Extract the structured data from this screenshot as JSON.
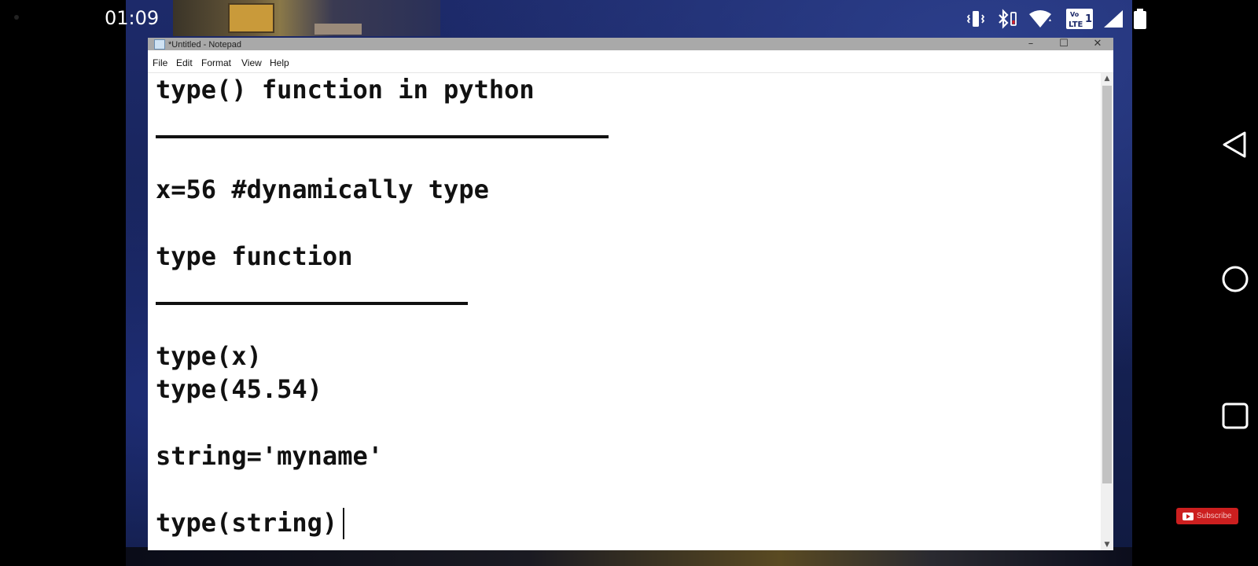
{
  "status_bar": {
    "time": "01:09",
    "icons": [
      "vibrate-icon",
      "bluetooth-icon",
      "wifi-icon",
      "volte-lte-icon",
      "cellular-signal-icon",
      "battery-icon"
    ],
    "lte_badge": "LTE 1"
  },
  "window": {
    "title": "*Untitled - Notepad",
    "controls": {
      "minimize": "–",
      "maximize": "☐",
      "close": "✕"
    }
  },
  "menu": [
    "File",
    "Edit",
    "Format",
    "View",
    "Help"
  ],
  "editor": {
    "lines": [
      "type() function in python",
      "x=56 #dynamically type",
      "type function",
      "type(x)",
      "type(45.54)",
      "string='myname'",
      "type(string)"
    ]
  },
  "nav_bar": {
    "icons": [
      "back-icon",
      "home-icon",
      "recents-icon"
    ]
  },
  "overlay": {
    "subscribe_label": "Subscribe"
  },
  "colors": {
    "subscribe_red": "#cc1f1f",
    "titlebar_gray": "#a9a9a9"
  }
}
